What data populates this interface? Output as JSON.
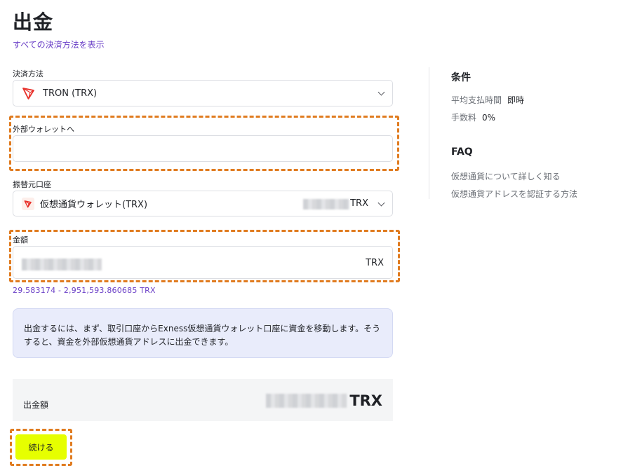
{
  "header": {
    "title": "出金",
    "all_methods_link": "すべての決済方法を表示"
  },
  "form": {
    "payment_method": {
      "label": "決済方法",
      "value": "TRON (TRX)",
      "icon": "tron-logo-icon"
    },
    "external_wallet": {
      "label": "外部ウォレットへ",
      "value": "",
      "placeholder": ""
    },
    "source_account": {
      "label": "振替元口座",
      "value": "仮想通貨ウォレット(TRX)",
      "currency": "TRX",
      "icon": "tron-logo-icon"
    },
    "amount": {
      "label": "金額",
      "currency": "TRX",
      "range": "29.583174 - 2,951,593.860685 TRX"
    }
  },
  "info": {
    "text": "出金するには、まず、取引口座からExness仮想通貨ウォレット口座に資金を移動します。そうすると、資金を外部仮想通貨アドレスに出金できます。"
  },
  "summary": {
    "label": "出金額",
    "currency": "TRX"
  },
  "actions": {
    "continue_label": "続ける"
  },
  "sidebar": {
    "conditions_title": "条件",
    "processing_label": "平均支払時間",
    "processing_value": "即時",
    "fee_label": "手数料",
    "fee_value": "0%",
    "faq_title": "FAQ",
    "faq_links": [
      "仮想通貨について詳しく知る",
      "仮想通貨アドレスを認証する方法"
    ]
  },
  "colors": {
    "accent_link": "#6a3fc7",
    "button_yellow": "#e6ff00",
    "highlight_orange": "#e07b1f",
    "tron_red": "#e8302a"
  }
}
